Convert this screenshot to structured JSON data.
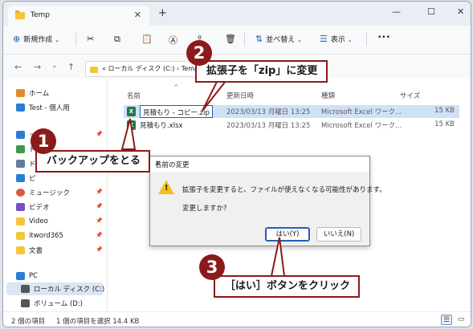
{
  "titlebar": {
    "tab_title": "Temp",
    "tab_close": "✕",
    "new_tab": "+",
    "minimize": "—",
    "maximize": "☐",
    "close": "✕"
  },
  "toolbar": {
    "new_label": "新規作成",
    "sort_label": "並べ替え",
    "view_label": "表示",
    "more_label": "•••"
  },
  "address": {
    "path": "« ローカル ディスク (C:)  ›  Temp"
  },
  "sidebar": {
    "items": [
      {
        "label": "ホーム",
        "color": "#e58a2b"
      },
      {
        "label": "Test - 個人用",
        "color": "#2b7cd3"
      },
      {
        "label": "ップ",
        "color": "#2b7cd3"
      },
      {
        "label": "ド",
        "color": "#3b9a4c"
      },
      {
        "label": "ピ",
        "color": "#2b7cd3"
      },
      {
        "label": "ミュージック",
        "color": "#e2573b"
      },
      {
        "label": "ビデオ",
        "color": "#7a4fc2"
      },
      {
        "label": "Video",
        "color": "#f3c53c"
      },
      {
        "label": "itword365",
        "color": "#f3c53c"
      },
      {
        "label": "文書",
        "color": "#f3c53c"
      },
      {
        "label": "PC",
        "color": "#2b7cd3"
      },
      {
        "label": "ローカル ディスク (C:)",
        "color": "#555555"
      },
      {
        "label": "ボリューム (D:)",
        "color": "#555555"
      }
    ]
  },
  "filelist": {
    "headers": {
      "name": "名前",
      "date": "更新日時",
      "type": "種類",
      "size": "サイズ"
    },
    "rows": [
      {
        "name": "見積もり - コピー.zip",
        "date": "2023/03/13 月曜日 13:25",
        "type": "Microsoft Excel ワーク...",
        "size": "15 KB"
      },
      {
        "name": "見積もり.xlsx",
        "date": "2023/03/13 月曜日 13:25",
        "type": "Microsoft Excel ワーク...",
        "size": "15 KB"
      }
    ]
  },
  "status": {
    "count": "2 個の項目",
    "selected": "1 個の項目を選択  14.4 KB"
  },
  "dialog": {
    "title": "名前の変更",
    "message1": "拡張子を変更すると、ファイルが使えなくなる可能性があります。",
    "message2": "変更しますか?",
    "yes": "はい(Y)",
    "no": "いいえ(N)"
  },
  "callouts": [
    {
      "num": "1",
      "text": "バックアップをとる"
    },
    {
      "num": "2",
      "text": "拡張子を「zip」に変更"
    },
    {
      "num": "3",
      "text": "［はい］ボタンをクリック"
    }
  ],
  "colors": {
    "accent": "#8c1a1a",
    "selection": "#cfe1f6",
    "excel": "#1f7a45"
  }
}
